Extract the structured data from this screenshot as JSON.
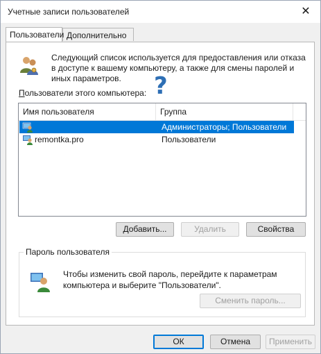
{
  "window": {
    "title": "Учетные записи пользователей",
    "close_glyph": "✕"
  },
  "tabs": [
    {
      "label": "Пользователи",
      "active": true
    },
    {
      "label": "Дополнительно",
      "active": false
    }
  ],
  "description": "Следующий список используется для предоставления или отказа в доступе к вашему компьютеру, а также для смены паролей и иных параметров.",
  "users_label": "Пользователи этого компьютера:",
  "users_label_underline": "П",
  "users_label_rest": "ользователи этого компьютера:",
  "overlay_mark": "?",
  "list": {
    "columns": [
      "Имя пользователя",
      "Группа"
    ],
    "rows": [
      {
        "name": "",
        "group": "Администраторы; Пользователи",
        "selected": true
      },
      {
        "name": "remontka.pro",
        "group": "Пользователи",
        "selected": false
      }
    ]
  },
  "buttons": {
    "add": "Добавить...",
    "remove": "Удалить",
    "properties": "Свойства",
    "change_password": "Сменить пароль...",
    "ok": "ОК",
    "cancel": "Отмена",
    "apply": "Применить"
  },
  "password_group": {
    "title": "Пароль пользователя",
    "text": "Чтобы изменить свой пароль, перейдите к параметрам компьютера и выберите \"Пользователи\"."
  },
  "icons": {
    "users": "users-icon",
    "user_row": "user-icon",
    "password": "user-password-icon"
  },
  "colors": {
    "selection": "#0078d7",
    "question_mark": "#2e6fb5",
    "window_bg": "#f0f0f0"
  }
}
